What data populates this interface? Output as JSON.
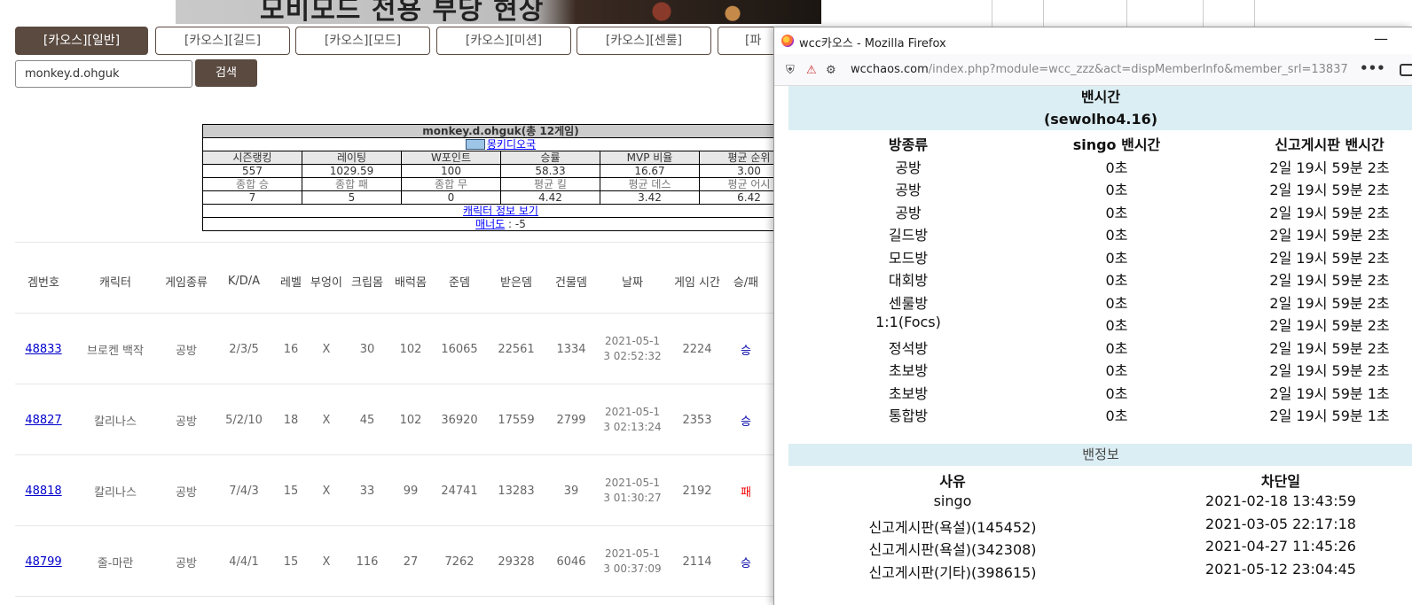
{
  "banner": {
    "text": "모비모드 전용 부당 현상"
  },
  "tabs": [
    "[카오스][일반]",
    "[카오스][길드]",
    "[카오스][모드]",
    "[카오스][미션]",
    "[카오스][센룰]",
    "[파"
  ],
  "search": {
    "value": "monkey.d.ohguk",
    "button": "검색"
  },
  "profile": {
    "title": "monkey.d.ohguk(총 12게임)",
    "server_link": "몽키디오국",
    "headers1": [
      "시즌랭킹",
      "레이팅",
      "W포인트",
      "승률",
      "MVP 비율",
      "평균 순위"
    ],
    "values1": [
      "557",
      "1029.59",
      "100",
      "58.33",
      "16.67",
      "3.00"
    ],
    "headers2": [
      "종합 승",
      "종합 패",
      "종합 무",
      "평균 킬",
      "평균 데스",
      "평균 어시"
    ],
    "values2": [
      "7",
      "5",
      "0",
      "4.42",
      "3.42",
      "6.42"
    ],
    "char_link": "캐릭터 정보 보기",
    "manner_label": "매너도",
    "manner_value": " : -5"
  },
  "games": {
    "headers": [
      "겜번호",
      "캐릭터",
      "게임종류",
      "K/D/A",
      "레벨",
      "부엉이",
      "크립몸",
      "배럭몸",
      "준뎀",
      "받은뎀",
      "건물뎀",
      "날짜",
      "게임 시간",
      "승/패"
    ],
    "rows": [
      {
        "id": "48833",
        "char": "브로켄 백작",
        "type": "공방",
        "kda": "2/3/5",
        "level": "16",
        "owl": "X",
        "creep": "30",
        "barrack": "102",
        "dealt": "16065",
        "taken": "22561",
        "building": "1334",
        "date1": "2021-05-1",
        "date2": "3 02:52:32",
        "time": "2224",
        "result": "승",
        "win": true
      },
      {
        "id": "48827",
        "char": "칼리나스",
        "type": "공방",
        "kda": "5/2/10",
        "level": "18",
        "owl": "X",
        "creep": "45",
        "barrack": "102",
        "dealt": "36920",
        "taken": "17559",
        "building": "2799",
        "date1": "2021-05-1",
        "date2": "3 02:13:24",
        "time": "2353",
        "result": "승",
        "win": true
      },
      {
        "id": "48818",
        "char": "칼리나스",
        "type": "공방",
        "kda": "7/4/3",
        "level": "15",
        "owl": "X",
        "creep": "33",
        "barrack": "99",
        "dealt": "24741",
        "taken": "13283",
        "building": "39",
        "date1": "2021-05-1",
        "date2": "3 01:30:27",
        "time": "2192",
        "result": "패",
        "win": false
      },
      {
        "id": "48799",
        "char": "줄-마란",
        "type": "공방",
        "kda": "4/4/1",
        "level": "15",
        "owl": "X",
        "creep": "116",
        "barrack": "27",
        "dealt": "7262",
        "taken": "29328",
        "building": "6046",
        "date1": "2021-05-1",
        "date2": "3 00:37:09",
        "time": "2114",
        "result": "승",
        "win": true
      }
    ]
  },
  "firefox": {
    "window_title": "wcc카오스 - Mozilla Firefox",
    "url_host": "wcchaos.com",
    "url_path": "/index.php?module=wcc_zzz&act=dispMemberInfo&member_srl=13837",
    "ban_title": "밴시간",
    "ban_subtitle": "(sewolho4.16)",
    "ban_headers": [
      "방종류",
      "singo 밴시간",
      "신고게시판 밴시간"
    ],
    "ban_rows": [
      [
        "공방",
        "0초",
        "2일 19시 59분 2초"
      ],
      [
        "공방",
        "0초",
        "2일 19시 59분 2초"
      ],
      [
        "공방",
        "0초",
        "2일 19시 59분 2초"
      ],
      [
        "길드방",
        "0초",
        "2일 19시 59분 2초"
      ],
      [
        "모드방",
        "0초",
        "2일 19시 59분 2초"
      ],
      [
        "대회방",
        "0초",
        "2일 19시 59분 2초"
      ],
      [
        "센룰방",
        "0초",
        "2일 19시 59분 2초"
      ],
      [
        "1:1(Focs)",
        "0초",
        "2일 19시 59분 2초"
      ],
      [
        "정석방",
        "0초",
        "2일 19시 59분 2초"
      ],
      [
        "초보방",
        "0초",
        "2일 19시 59분 2초"
      ],
      [
        "초보방",
        "0초",
        "2일 19시 59분 1초"
      ],
      [
        "통합방",
        "0초",
        "2일 19시 59분 1초"
      ]
    ],
    "info_title": "밴정보",
    "info_headers": [
      "사유",
      "차단일"
    ],
    "info_rows": [
      [
        "singo",
        "2021-02-18 13:43:59"
      ],
      [
        "신고게시판(욕설)(145452)",
        "2021-03-05 22:17:18"
      ],
      [
        "신고게시판(욕설)(342308)",
        "2021-04-27 11:45:26"
      ],
      [
        "신고게시판(기타)(398615)",
        "2021-05-12 23:04:45"
      ]
    ]
  }
}
